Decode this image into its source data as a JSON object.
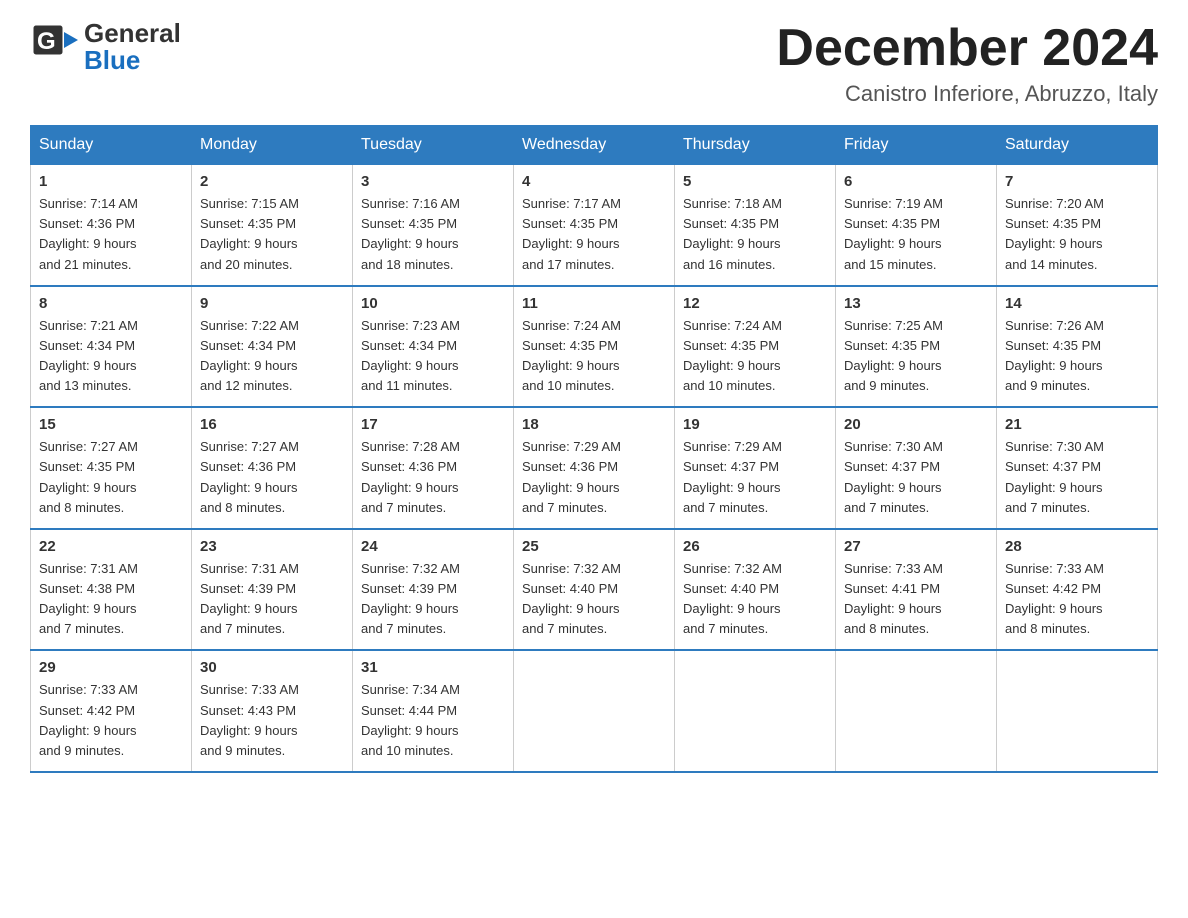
{
  "header": {
    "logo_general": "General",
    "logo_blue": "Blue",
    "month_title": "December 2024",
    "location": "Canistro Inferiore, Abruzzo, Italy"
  },
  "weekdays": [
    "Sunday",
    "Monday",
    "Tuesday",
    "Wednesday",
    "Thursday",
    "Friday",
    "Saturday"
  ],
  "weeks": [
    [
      {
        "day": "1",
        "sunrise": "7:14 AM",
        "sunset": "4:36 PM",
        "daylight": "9 hours and 21 minutes."
      },
      {
        "day": "2",
        "sunrise": "7:15 AM",
        "sunset": "4:35 PM",
        "daylight": "9 hours and 20 minutes."
      },
      {
        "day": "3",
        "sunrise": "7:16 AM",
        "sunset": "4:35 PM",
        "daylight": "9 hours and 18 minutes."
      },
      {
        "day": "4",
        "sunrise": "7:17 AM",
        "sunset": "4:35 PM",
        "daylight": "9 hours and 17 minutes."
      },
      {
        "day": "5",
        "sunrise": "7:18 AM",
        "sunset": "4:35 PM",
        "daylight": "9 hours and 16 minutes."
      },
      {
        "day": "6",
        "sunrise": "7:19 AM",
        "sunset": "4:35 PM",
        "daylight": "9 hours and 15 minutes."
      },
      {
        "day": "7",
        "sunrise": "7:20 AM",
        "sunset": "4:35 PM",
        "daylight": "9 hours and 14 minutes."
      }
    ],
    [
      {
        "day": "8",
        "sunrise": "7:21 AM",
        "sunset": "4:34 PM",
        "daylight": "9 hours and 13 minutes."
      },
      {
        "day": "9",
        "sunrise": "7:22 AM",
        "sunset": "4:34 PM",
        "daylight": "9 hours and 12 minutes."
      },
      {
        "day": "10",
        "sunrise": "7:23 AM",
        "sunset": "4:34 PM",
        "daylight": "9 hours and 11 minutes."
      },
      {
        "day": "11",
        "sunrise": "7:24 AM",
        "sunset": "4:35 PM",
        "daylight": "9 hours and 10 minutes."
      },
      {
        "day": "12",
        "sunrise": "7:24 AM",
        "sunset": "4:35 PM",
        "daylight": "9 hours and 10 minutes."
      },
      {
        "day": "13",
        "sunrise": "7:25 AM",
        "sunset": "4:35 PM",
        "daylight": "9 hours and 9 minutes."
      },
      {
        "day": "14",
        "sunrise": "7:26 AM",
        "sunset": "4:35 PM",
        "daylight": "9 hours and 9 minutes."
      }
    ],
    [
      {
        "day": "15",
        "sunrise": "7:27 AM",
        "sunset": "4:35 PM",
        "daylight": "9 hours and 8 minutes."
      },
      {
        "day": "16",
        "sunrise": "7:27 AM",
        "sunset": "4:36 PM",
        "daylight": "9 hours and 8 minutes."
      },
      {
        "day": "17",
        "sunrise": "7:28 AM",
        "sunset": "4:36 PM",
        "daylight": "9 hours and 7 minutes."
      },
      {
        "day": "18",
        "sunrise": "7:29 AM",
        "sunset": "4:36 PM",
        "daylight": "9 hours and 7 minutes."
      },
      {
        "day": "19",
        "sunrise": "7:29 AM",
        "sunset": "4:37 PM",
        "daylight": "9 hours and 7 minutes."
      },
      {
        "day": "20",
        "sunrise": "7:30 AM",
        "sunset": "4:37 PM",
        "daylight": "9 hours and 7 minutes."
      },
      {
        "day": "21",
        "sunrise": "7:30 AM",
        "sunset": "4:37 PM",
        "daylight": "9 hours and 7 minutes."
      }
    ],
    [
      {
        "day": "22",
        "sunrise": "7:31 AM",
        "sunset": "4:38 PM",
        "daylight": "9 hours and 7 minutes."
      },
      {
        "day": "23",
        "sunrise": "7:31 AM",
        "sunset": "4:39 PM",
        "daylight": "9 hours and 7 minutes."
      },
      {
        "day": "24",
        "sunrise": "7:32 AM",
        "sunset": "4:39 PM",
        "daylight": "9 hours and 7 minutes."
      },
      {
        "day": "25",
        "sunrise": "7:32 AM",
        "sunset": "4:40 PM",
        "daylight": "9 hours and 7 minutes."
      },
      {
        "day": "26",
        "sunrise": "7:32 AM",
        "sunset": "4:40 PM",
        "daylight": "9 hours and 7 minutes."
      },
      {
        "day": "27",
        "sunrise": "7:33 AM",
        "sunset": "4:41 PM",
        "daylight": "9 hours and 8 minutes."
      },
      {
        "day": "28",
        "sunrise": "7:33 AM",
        "sunset": "4:42 PM",
        "daylight": "9 hours and 8 minutes."
      }
    ],
    [
      {
        "day": "29",
        "sunrise": "7:33 AM",
        "sunset": "4:42 PM",
        "daylight": "9 hours and 9 minutes."
      },
      {
        "day": "30",
        "sunrise": "7:33 AM",
        "sunset": "4:43 PM",
        "daylight": "9 hours and 9 minutes."
      },
      {
        "day": "31",
        "sunrise": "7:34 AM",
        "sunset": "4:44 PM",
        "daylight": "9 hours and 10 minutes."
      },
      null,
      null,
      null,
      null
    ]
  ],
  "labels": {
    "sunrise": "Sunrise:",
    "sunset": "Sunset:",
    "daylight": "Daylight:"
  }
}
